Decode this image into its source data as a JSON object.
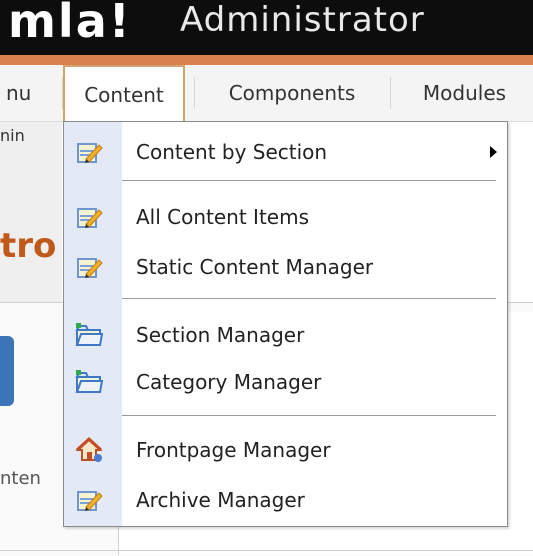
{
  "header": {
    "logo_text": "mla!",
    "subtitle": "Administrator"
  },
  "menubar": {
    "items": [
      {
        "label": "nu"
      },
      {
        "label": "Content"
      },
      {
        "label": "Components"
      },
      {
        "label": "Modules"
      }
    ]
  },
  "background": {
    "admin_fragment": "nin",
    "title_fragment": "tro",
    "conte_fragment": "nten"
  },
  "dropdown": {
    "items": [
      {
        "label": "Content by Section",
        "icon": "edit-icon",
        "submenu": true
      },
      {
        "label": "All Content Items",
        "icon": "edit-icon"
      },
      {
        "label": "Static Content Manager",
        "icon": "edit-icon"
      },
      {
        "label": "Section Manager",
        "icon": "folder-icon"
      },
      {
        "label": "Category Manager",
        "icon": "folder-icon"
      },
      {
        "label": "Frontpage Manager",
        "icon": "home-icon"
      },
      {
        "label": "Archive Manager",
        "icon": "edit-icon"
      }
    ]
  },
  "colors": {
    "header_bg": "#0d0d0d",
    "accent_orange": "#d9824d",
    "menu_active_border": "#cfa46d",
    "gutter": "#e4e9f6"
  }
}
